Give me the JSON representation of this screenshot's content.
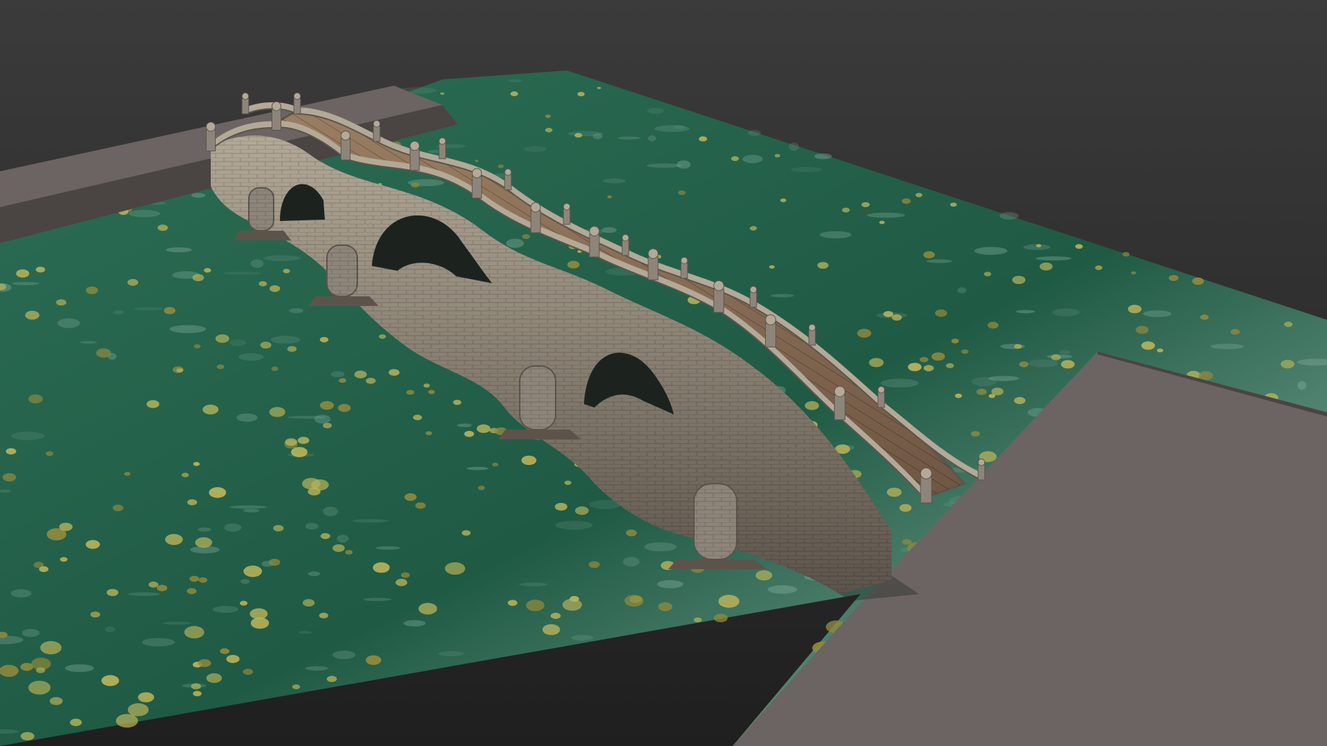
{
  "scene": {
    "subject": "",
    "colors": {
      "background_top": "#3b3b3b",
      "background_bottom": "#1f1f1f",
      "water_deep": "#1f5a44",
      "water_mid": "#2d6e55",
      "water_light": "#8fb6a8",
      "lily_pad": "#b8b35a",
      "lily_pad_dark": "#8f8a3c",
      "bank": "#6b6462",
      "bank_side": "#4a4442",
      "stone": "#8e857a",
      "stone_dark": "#5c544b",
      "stone_light": "#b3a997",
      "deck": "#9a7e63",
      "deck_dark": "#6f5643",
      "arch_shadow": "#1c231f"
    }
  }
}
